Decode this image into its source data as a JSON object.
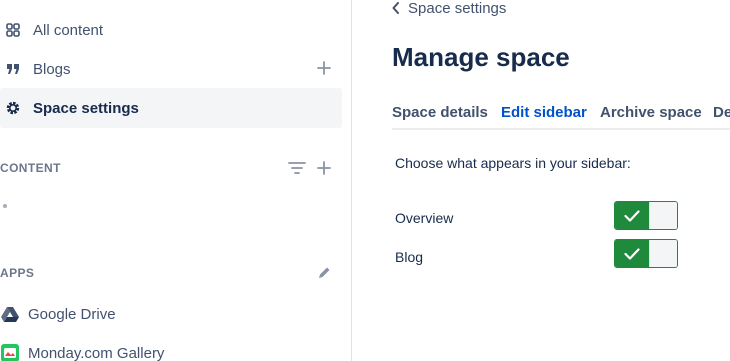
{
  "sidebar": {
    "items": [
      {
        "label": "All content",
        "icon": "grid-icon"
      },
      {
        "label": "Blogs",
        "icon": "quote-icon"
      },
      {
        "label": "Space settings",
        "icon": "gear-icon",
        "selected": true
      }
    ],
    "content_section": {
      "title": "CONTENT"
    },
    "apps_section": {
      "title": "APPS",
      "apps": [
        {
          "label": "Google Drive",
          "icon": "google-drive-icon"
        },
        {
          "label": "Monday.com Gallery",
          "icon": "monday-gallery-icon"
        }
      ]
    }
  },
  "main": {
    "back_link": "Space settings",
    "title": "Manage space",
    "tabs": [
      {
        "label": "Space details"
      },
      {
        "label": "Edit sidebar",
        "active": true
      },
      {
        "label": "Archive space"
      },
      {
        "label": "De"
      }
    ],
    "intro": "Choose what appears in your sidebar:",
    "options": [
      {
        "label": "Overview",
        "enabled": true
      },
      {
        "label": "Blog",
        "enabled": true
      }
    ]
  },
  "colors": {
    "accent": "#0052cc",
    "toggle_on": "#1f8a3b",
    "selected_bg": "#f4f5f7"
  }
}
